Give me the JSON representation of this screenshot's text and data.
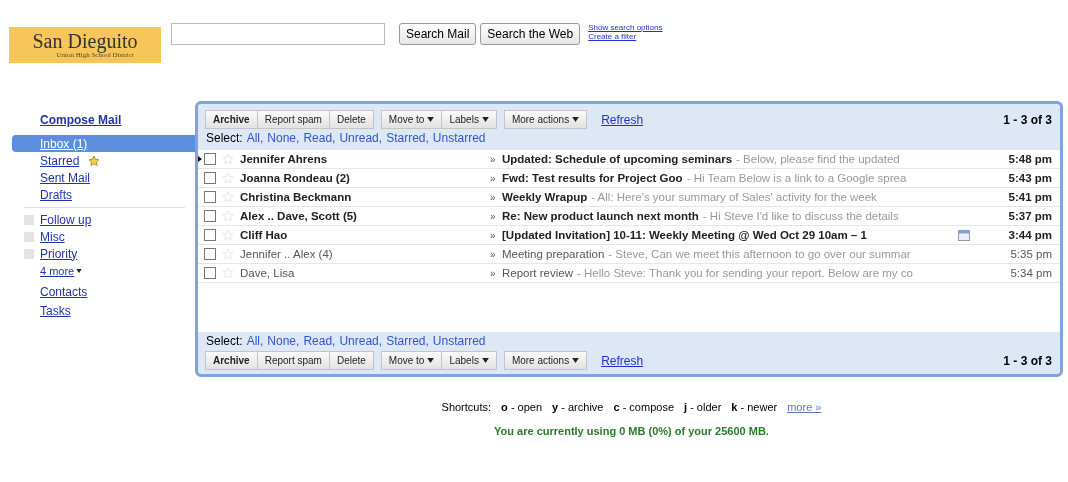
{
  "logo": {
    "title": "San Dieguito",
    "subtitle": "Union High School District"
  },
  "search": {
    "buttons": [
      "Search Mail",
      "Search the Web"
    ],
    "links": [
      "Show search options",
      "Create a filter"
    ]
  },
  "sidebar": {
    "compose": "Compose Mail",
    "system_items": [
      {
        "label": "Inbox (1)",
        "selected": true,
        "kind": "folder"
      },
      {
        "label": "Starred",
        "selected": false,
        "kind": "starred"
      },
      {
        "label": "Sent Mail",
        "selected": false,
        "kind": "folder"
      },
      {
        "label": "Drafts",
        "selected": false,
        "kind": "folder"
      }
    ],
    "labels": [
      {
        "label": "Follow up",
        "color": "#e4e4e4"
      },
      {
        "label": "Misc",
        "color": "#e4e4e4"
      },
      {
        "label": "Priority",
        "color": "#e4e4e4"
      }
    ],
    "more": "4 more",
    "links": [
      "Contacts",
      "Tasks"
    ]
  },
  "toolbar_top": {
    "groups": [
      [
        {
          "label": "Archive",
          "bold": true,
          "dropdown": false
        },
        {
          "label": "Report spam",
          "bold": false,
          "dropdown": false
        },
        {
          "label": "Delete",
          "bold": false,
          "dropdown": false
        }
      ],
      [
        {
          "label": "Move to",
          "bold": false,
          "dropdown": true
        },
        {
          "label": "Labels",
          "bold": false,
          "dropdown": true
        }
      ],
      [
        {
          "label": "More actions",
          "bold": false,
          "dropdown": true
        }
      ]
    ],
    "refresh": "Refresh",
    "range": "1 - 3 of 3"
  },
  "select_top": {
    "label": "Select:",
    "links": [
      "All,",
      "None,",
      "Read,",
      "Unread,",
      "Starred,",
      "Unstarred"
    ]
  },
  "messages": [
    {
      "sender": "Jennifer Ahrens",
      "marker": "»",
      "subject": "Updated: Schedule of upcoming seminars",
      "snippet": "- Below, please find the updated",
      "time": "5:48 pm",
      "unread": true,
      "current": true,
      "invite": false,
      "checked": false,
      "starred": false
    },
    {
      "sender": "Joanna Rondeau (2)",
      "marker": "»",
      "subject": "Fwd: Test results for Project Goo",
      "snippet": "- Hi Team Below is a link to a Google sprea",
      "time": "5:43 pm",
      "unread": true,
      "current": false,
      "invite": false,
      "checked": false,
      "starred": false
    },
    {
      "sender": "Christina Beckmann",
      "marker": "»",
      "subject": "Weekly Wrapup",
      "snippet": "- All: Here's your summary of Sales' activity for the week",
      "time": "5:41 pm",
      "unread": true,
      "current": false,
      "invite": false,
      "checked": false,
      "starred": false
    },
    {
      "sender": "Alex .. Dave, Scott (5)",
      "marker": "»",
      "subject": "Re: New product launch next month",
      "snippet": "- Hi Steve I'd like to discuss the details",
      "time": "5:37 pm",
      "unread": true,
      "current": false,
      "invite": false,
      "checked": false,
      "starred": false
    },
    {
      "sender": "Cliff Hao",
      "marker": "»",
      "subject": "[Updated Invitation] 10-11: Weekly Meeting @ Wed Oct 29 10am – 1",
      "time": "3:44 pm",
      "unread": true,
      "current": false,
      "invite": true,
      "checked": false,
      "starred": false
    },
    {
      "sender": "Jennifer .. Alex (4)",
      "marker": "»",
      "subject": "Meeting preparation",
      "snippet": "- Steve, Can we meet this afternoon to go over our summar",
      "time": "5:35 pm",
      "unread": false,
      "current": false,
      "invite": false,
      "checked": false,
      "starred": false
    },
    {
      "sender": "Dave, Lisa",
      "marker": "»",
      "subject": "Report review",
      "snippet": "- Hello Steve: Thank you for sending your report. Below are my co",
      "time": "5:34 pm",
      "unread": false,
      "current": false,
      "invite": false,
      "checked": false,
      "starred": false
    }
  ],
  "select_bottom": {
    "label": "Select:",
    "links": [
      "All,",
      "None,",
      "Read,",
      "Unread,",
      "Starred,",
      "Unstarred"
    ]
  },
  "toolbar_bottom": {
    "groups": [
      [
        {
          "label": "Archive",
          "bold": true,
          "dropdown": false
        },
        {
          "label": "Report spam",
          "bold": false,
          "dropdown": false
        },
        {
          "label": "Delete",
          "bold": false,
          "dropdown": false
        }
      ],
      [
        {
          "label": "Move to",
          "bold": false,
          "dropdown": true
        },
        {
          "label": "Labels",
          "bold": false,
          "dropdown": true
        }
      ],
      [
        {
          "label": "More actions",
          "bold": false,
          "dropdown": true
        }
      ]
    ],
    "refresh": "Refresh",
    "range": "1 - 3 of 3"
  },
  "footer": {
    "shortcuts_label": "Shortcuts:",
    "shortcuts": [
      {
        "key": "o",
        "action": "- open"
      },
      {
        "key": "y",
        "action": "- archive"
      },
      {
        "key": "c",
        "action": "- compose"
      },
      {
        "key": "j",
        "action": "- older"
      },
      {
        "key": "k",
        "action": "- newer"
      }
    ],
    "more": "more »",
    "storage": "You are currently using 0 MB (0%) of your 25600 MB."
  }
}
